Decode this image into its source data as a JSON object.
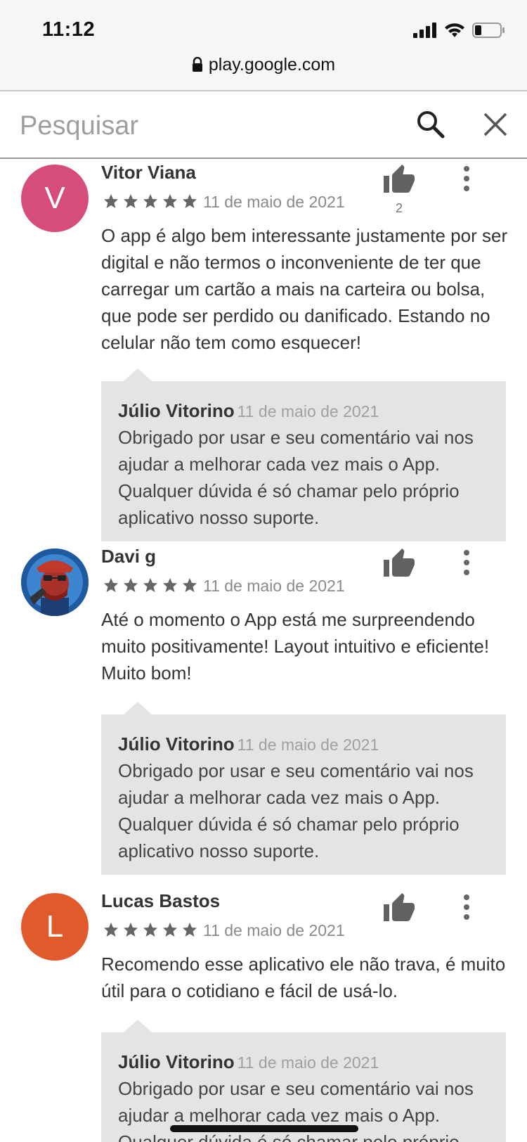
{
  "status_bar": {
    "time": "11:12",
    "url": "play.google.com",
    "icons": [
      "signal-icon",
      "wifi-icon",
      "battery-icon"
    ]
  },
  "search": {
    "placeholder": "Pesquisar",
    "value": "",
    "search_icon": "search-icon",
    "close_icon": "close-icon"
  },
  "reviews": [
    {
      "avatar_letter": "V",
      "avatar_color": "#d64d7a",
      "name": "Vitor Viana",
      "rating": 5,
      "date": "11 de maio de 2021",
      "likes": "2",
      "text": "O app é algo bem interessante justamente por ser digital e não termos o inconveniente de ter que carregar um cartão a mais na carteira ou bolsa, que pode ser perdido ou danificado. Estando no celular não tem como esquecer!",
      "reply": {
        "name": "Júlio Vitorino",
        "date": "11 de maio de 2021",
        "text": "Obrigado por usar e seu comentário vai nos ajudar a melhorar cada vez mais o App. Qualquer dúvida é só chamar pelo próprio aplicativo nosso suporte."
      }
    },
    {
      "avatar_letter": "",
      "avatar_color": "#2d6fb8",
      "name": "Davi g",
      "rating": 5,
      "date": "11 de maio de 2021",
      "likes": "",
      "text": "Até o momento o App está me surpreendendo muito positivamente! Layout intuitivo e eficiente! Muito bom!",
      "reply": {
        "name": "Júlio Vitorino",
        "date": "11 de maio de 2021",
        "text": "Obrigado por usar e seu comentário vai nos ajudar a melhorar cada vez mais o App. Qualquer dúvida é só chamar pelo próprio aplicativo nosso suporte."
      }
    },
    {
      "avatar_letter": "L",
      "avatar_color": "#e05a2c",
      "name": "Lucas Bastos",
      "rating": 5,
      "date": "11 de maio de 2021",
      "likes": "",
      "text": "Recomendo esse aplicativo ele não trava, é muito útil para o cotidiano e fácil de usá-lo.",
      "reply": {
        "name": "Júlio Vitorino",
        "date": "11 de maio de 2021",
        "text": "Obrigado por usar e seu comentário vai nos ajudar a melhorar cada vez mais o App. Qualquer dúvida é só chamar pelo próprio aplicativo nosso suporte."
      }
    }
  ]
}
